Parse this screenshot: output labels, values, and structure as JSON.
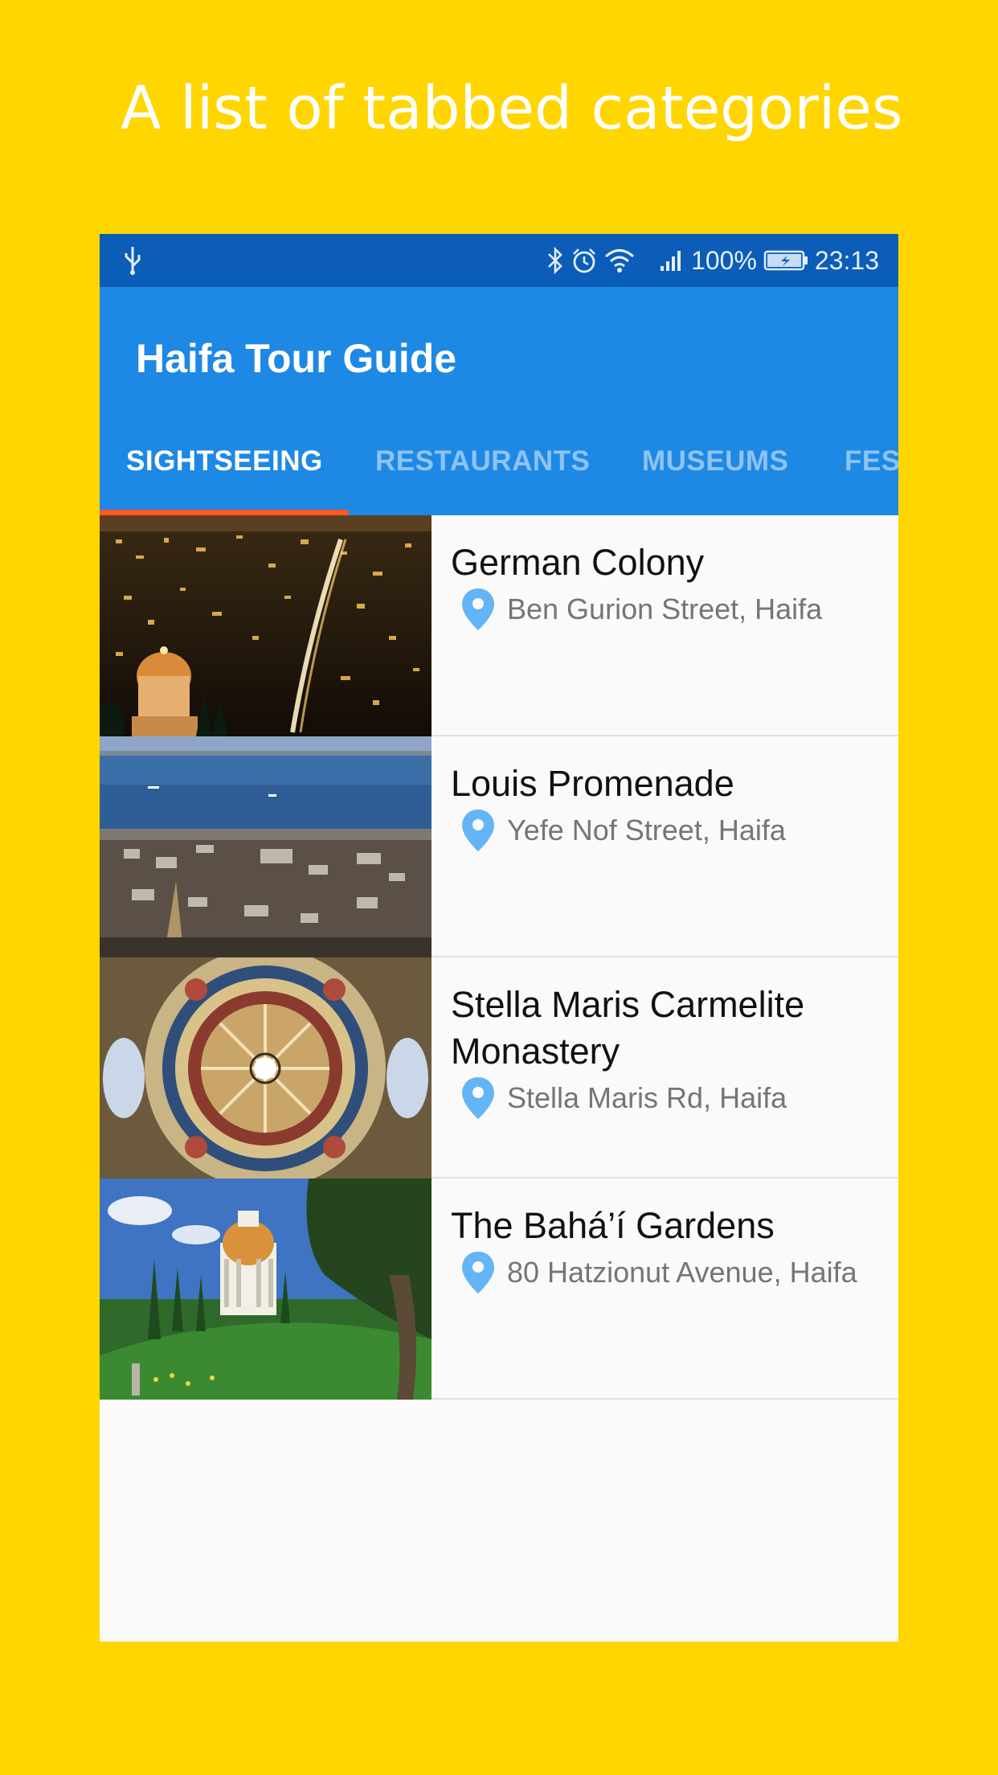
{
  "promo": {
    "title": "A list of tabbed categories"
  },
  "statusbar": {
    "left_icon": "usb-icon",
    "icons": [
      "bluetooth-icon",
      "alarm-icon",
      "wifi-icon",
      "signal-icon"
    ],
    "battery_percent": "100%",
    "battery_icon": "battery-charging-icon",
    "time": "23:13"
  },
  "appbar": {
    "title": "Haifa Tour Guide"
  },
  "tabs": [
    {
      "label": "SIGHTSEEING",
      "selected": true
    },
    {
      "label": "RESTAURANTS",
      "selected": false
    },
    {
      "label": "MUSEUMS",
      "selected": false
    },
    {
      "label": "FES",
      "selected": false
    }
  ],
  "places": [
    {
      "name": "German Colony",
      "address": "Ben Gurion Street, Haifa",
      "image": "night-city-photo"
    },
    {
      "name": "Louis Promenade",
      "address": "Yefe Nof Street, Haifa",
      "image": "harbor-view-photo"
    },
    {
      "name": "Stella Maris Carmelite Monastery",
      "address": "Stella Maris Rd, Haifa",
      "image": "dome-ceiling-photo"
    },
    {
      "name": "The Bahá’í Gardens",
      "address": "80 Hatzionut Avenue, Haifa",
      "image": "gardens-shrine-photo"
    }
  ],
  "colors": {
    "background": "#FFD600",
    "statusbar": "#0B5DB8",
    "appbar": "#1E88E5",
    "tab_indicator": "#FF5722",
    "pin": "#64B5F6"
  }
}
